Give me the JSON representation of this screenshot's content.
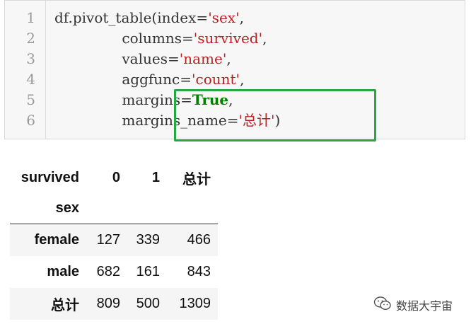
{
  "code": {
    "line_numbers": [
      "1",
      "2",
      "3",
      "4",
      "5",
      "6"
    ],
    "lines": [
      [
        {
          "t": "df.pivot_table(index=",
          "c": "plain"
        },
        {
          "t": "'sex'",
          "c": "str"
        },
        {
          "t": ",",
          "c": "plain"
        }
      ],
      [
        {
          "t": "               columns=",
          "c": "plain"
        },
        {
          "t": "'survived'",
          "c": "str"
        },
        {
          "t": ",",
          "c": "plain"
        }
      ],
      [
        {
          "t": "               values=",
          "c": "plain"
        },
        {
          "t": "'name'",
          "c": "str"
        },
        {
          "t": ",",
          "c": "plain"
        }
      ],
      [
        {
          "t": "               aggfunc=",
          "c": "plain"
        },
        {
          "t": "'count'",
          "c": "str"
        },
        {
          "t": ",",
          "c": "plain"
        }
      ],
      [
        {
          "t": "               margins=",
          "c": "plain"
        },
        {
          "t": "True",
          "c": "kw"
        },
        {
          "t": ",",
          "c": "plain"
        }
      ],
      [
        {
          "t": "               margins_name=",
          "c": "plain"
        },
        {
          "t": "'总计'",
          "c": "str"
        },
        {
          "t": ")",
          "c": "plain"
        }
      ]
    ],
    "highlight_color": "#28a745",
    "string_color": "#ba2121",
    "keyword_color": "#008000"
  },
  "table": {
    "columns_label": "survived",
    "columns": [
      "0",
      "1",
      "总计"
    ],
    "index_label": "sex",
    "rows": [
      {
        "index": "female",
        "values": [
          "127",
          "339",
          "466"
        ]
      },
      {
        "index": "male",
        "values": [
          "682",
          "161",
          "843"
        ]
      },
      {
        "index": "总计",
        "values": [
          "809",
          "500",
          "1309"
        ]
      }
    ]
  },
  "watermark": {
    "icon": "wechat-icon",
    "text": "数据大宇宙"
  }
}
